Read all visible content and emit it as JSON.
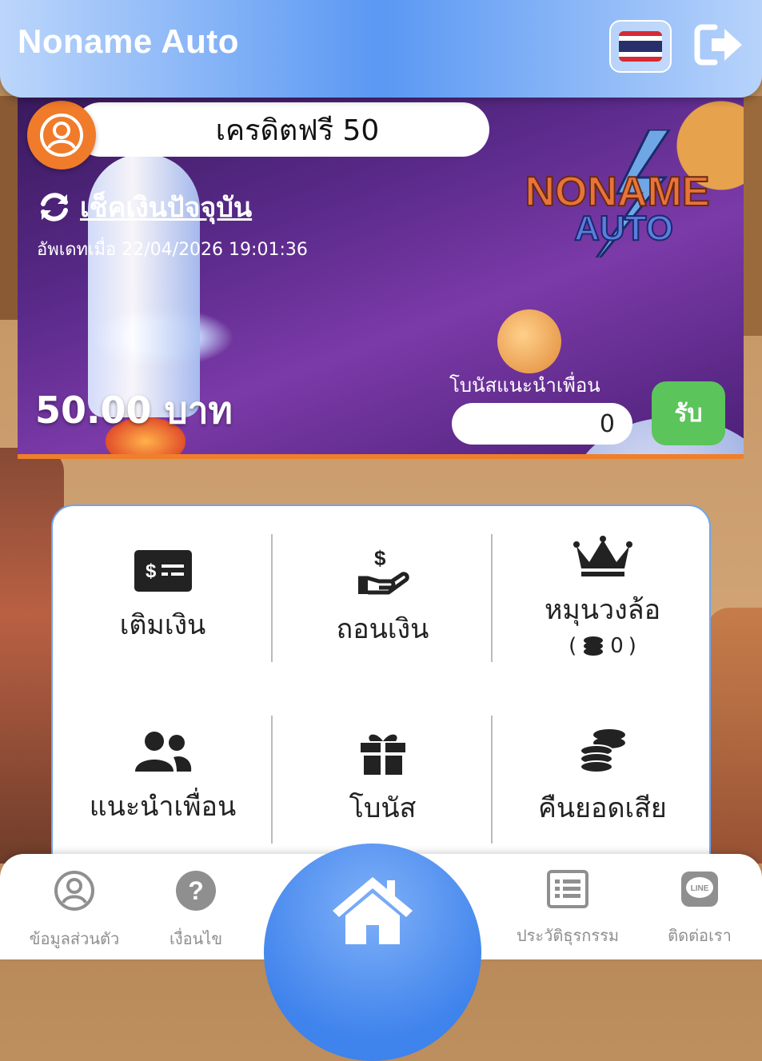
{
  "header": {
    "app_title": "Noname Auto",
    "language_icon": "thailand-flag-icon",
    "logout_icon": "logout-icon"
  },
  "banner": {
    "promo_label": "เครดิตฟรี 50",
    "check_balance_label": "เช็คเงินปัจจุบัน",
    "updated_label": "อัพเดทเมื่อ 22/04/2026 19:01:36",
    "balance": "50.00 บาท",
    "referral_bonus_label": "โบนัสแนะนำเพื่อน",
    "referral_bonus_value": "0",
    "claim_label": "รับ",
    "brand_logo_text_1": "NONAME",
    "brand_logo_text_2": "AUTO"
  },
  "menu": {
    "deposit": "เติมเงิน",
    "withdraw": "ถอนเงิน",
    "wheel": "หมุนวงล้อ",
    "wheel_coins": "0",
    "refer_friend": "แนะนำเพื่อน",
    "bonus": "โบนัส",
    "cashback": "คืนยอดเสีย"
  },
  "bottom_nav": {
    "profile": "ข้อมูลส่วนตัว",
    "terms": "เงื่อนไข",
    "history": "ประวัติธุรกรรม",
    "contact": "ติดต่อเรา"
  },
  "colors": {
    "header_accent": "#5a98f3",
    "claim_green": "#5bc45b",
    "avatar_orange": "#f07b2a"
  }
}
